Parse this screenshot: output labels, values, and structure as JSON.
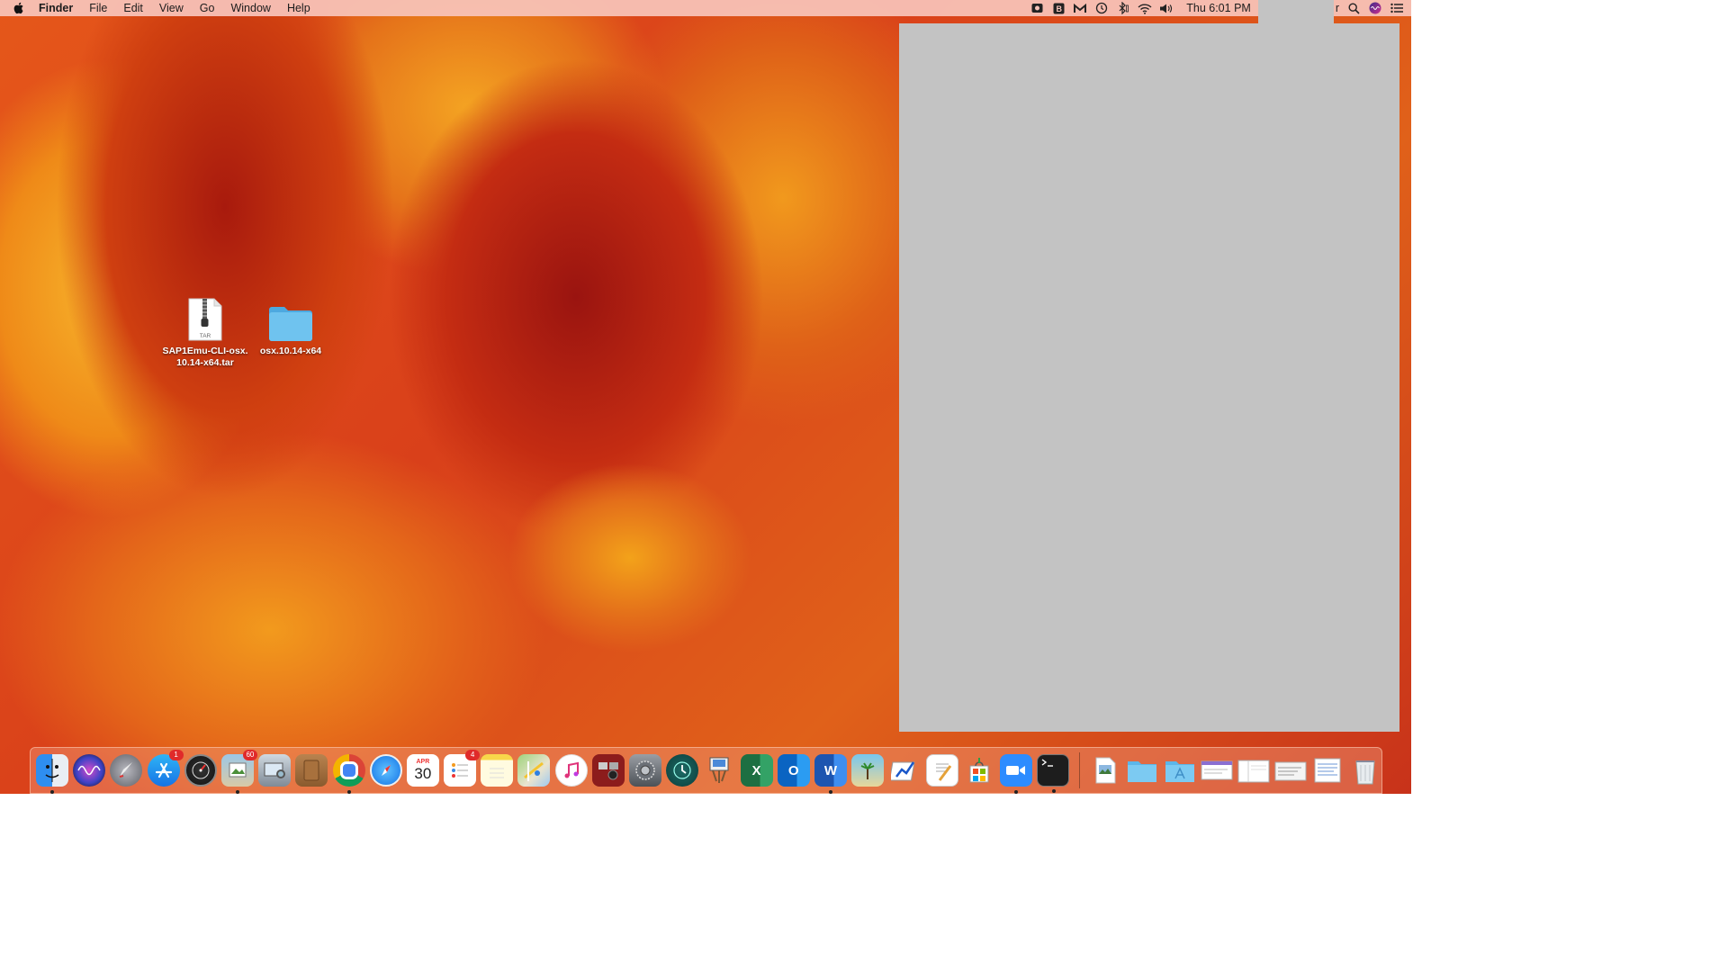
{
  "menubar": {
    "app_name": "Finder",
    "menus": [
      "File",
      "Edit",
      "View",
      "Go",
      "Window",
      "Help"
    ],
    "clock": "Thu 6:01 PM",
    "clipped_text": "r",
    "status_icons": [
      "screen-record-icon",
      "b-app-icon",
      "gmail-icon",
      "time-machine-icon",
      "bluetooth-icon",
      "wifi-icon",
      "volume-icon",
      "spotlight-icon",
      "siri-icon",
      "notification-center-icon"
    ]
  },
  "desktop": {
    "items": [
      {
        "label": "SAP1Emu-CLI-osx.\n10.14-x64.tar",
        "type_badge": "TAR"
      },
      {
        "label": "osx.10.14-x64"
      }
    ]
  },
  "dock": {
    "calendar": {
      "month": "APR",
      "day": "30"
    },
    "badges": {
      "app_store": "1",
      "preview": "60",
      "reminders": "4"
    }
  },
  "colors": {
    "menubar": "#f7c4ba",
    "redacted_panel": "#c3c3c3",
    "folder": "#6fc3ef"
  }
}
